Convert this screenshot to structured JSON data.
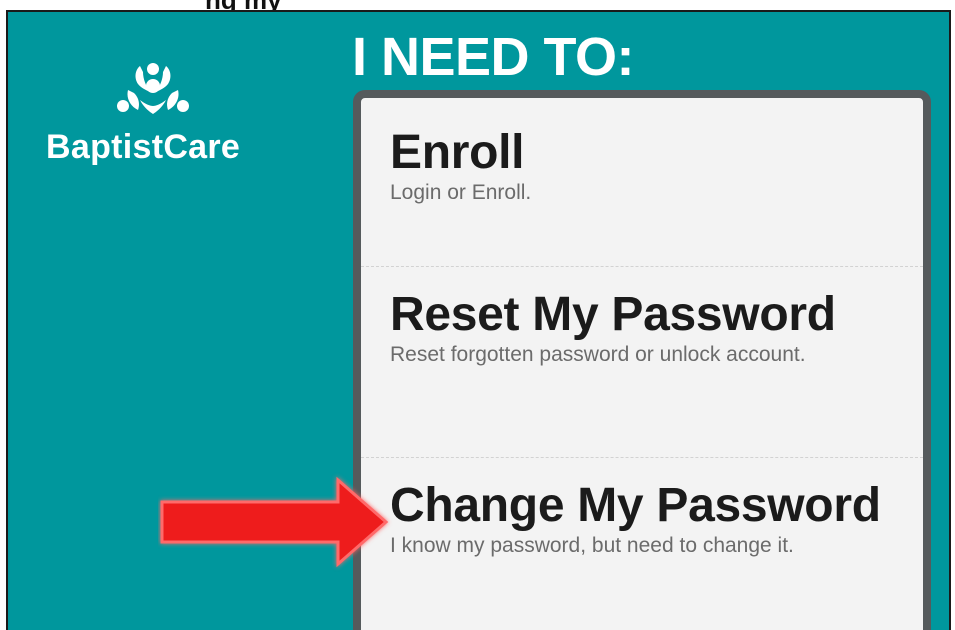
{
  "top_fragment": "ng my",
  "logo": {
    "text": "BaptistCare",
    "icon": "baptistcare-logo-icon"
  },
  "heading": "I NEED TO:",
  "menu": {
    "options": [
      {
        "title": "Enroll",
        "description": "Login or Enroll."
      },
      {
        "title": "Reset My Password",
        "description": "Reset forgotten password or unlock account."
      },
      {
        "title": "Change My Password",
        "description": "I know my password, but need to change it."
      }
    ]
  },
  "annotation": {
    "icon": "red-arrow-icon",
    "points_to": "Change My Password"
  },
  "colors": {
    "background": "#00979d",
    "panel": "#f3f3f3",
    "panel_border": "#555a5c",
    "arrow": "#ee1c1c"
  }
}
